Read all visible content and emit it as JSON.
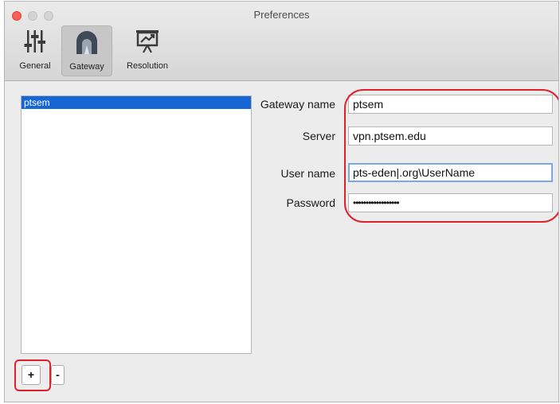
{
  "window": {
    "title": "Preferences"
  },
  "toolbar": {
    "items": [
      {
        "label": "General",
        "icon": "sliders-icon"
      },
      {
        "label": "Gateway",
        "icon": "tunnel-icon",
        "selected": true
      },
      {
        "label": "Resolution",
        "icon": "monitor-icon"
      }
    ]
  },
  "gateways": {
    "items": [
      "ptsem"
    ],
    "selected": "ptsem",
    "add_label": "+",
    "remove_label": "-"
  },
  "form": {
    "gateway_name": {
      "label": "Gateway name",
      "value": "ptsem"
    },
    "server": {
      "label": "Server",
      "value": "vpn.ptsem.edu"
    },
    "user_name": {
      "label": "User name",
      "value": "pts-eden|.org\\UserName"
    },
    "password": {
      "label": "Password",
      "value": "••••••••••••••••••"
    }
  },
  "colors": {
    "selection": "#1666d6",
    "annotation": "#e0202a",
    "close_button": "#fc5f57",
    "focus_ring": "#79a8e6"
  }
}
